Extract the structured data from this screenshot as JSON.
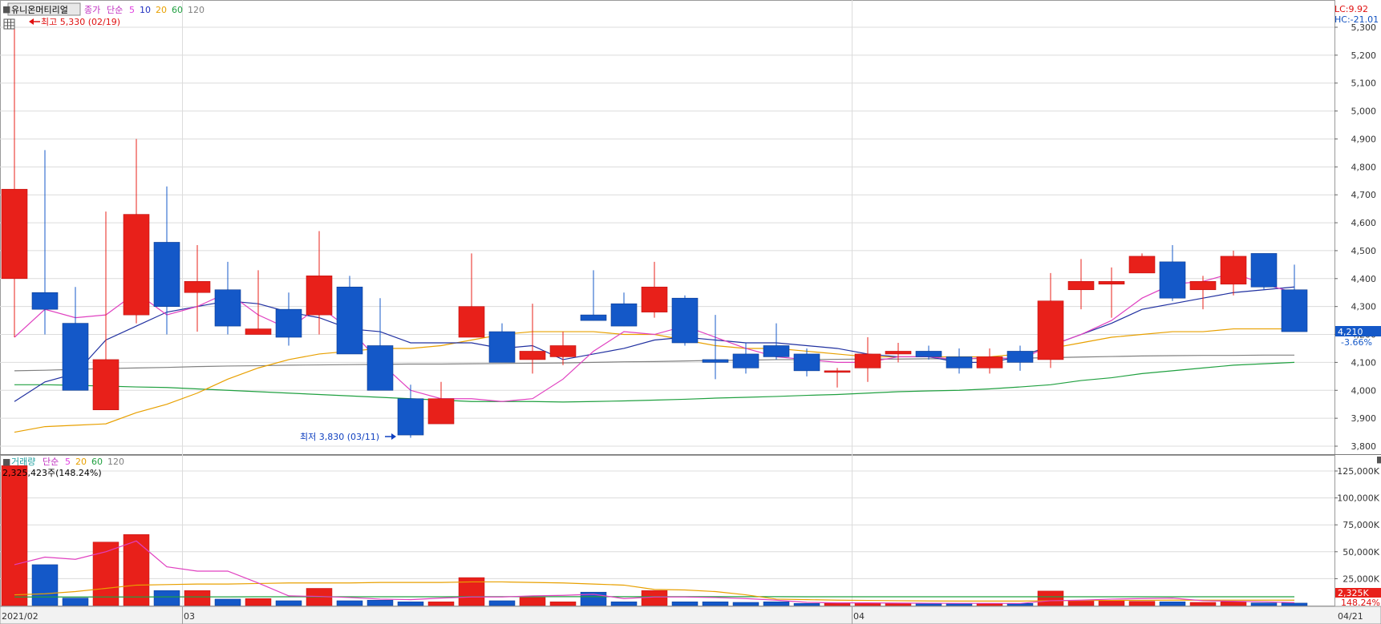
{
  "header": {
    "stock_name": "유니온머티리얼",
    "price_legend": [
      {
        "text": "종가",
        "color": "#c030c0"
      },
      {
        "text": "단순",
        "color": "#c030c0"
      },
      {
        "text": "5",
        "color": "#e040e0"
      },
      {
        "text": "10",
        "color": "#2030c0"
      },
      {
        "text": "20",
        "color": "#e8a000"
      },
      {
        "text": "60",
        "color": "#20a040"
      },
      {
        "text": "120",
        "color": "#808080"
      }
    ],
    "volume_legend": [
      {
        "text": "거래량",
        "color": "#20a0a0"
      },
      {
        "text": "단순",
        "color": "#c030c0"
      },
      {
        "text": "5",
        "color": "#e040e0"
      },
      {
        "text": "20",
        "color": "#e8a000"
      },
      {
        "text": "60",
        "color": "#20a040"
      },
      {
        "text": "120",
        "color": "#808080"
      }
    ],
    "lc": "LC:9.92",
    "hc": "HC:-21.01"
  },
  "annotations": {
    "high": "최고 5,330 (02/19)",
    "low": "최저 3,830 (03/11)",
    "current_price": "4,210",
    "change_pct": "-3.66%",
    "volume_info": "2,325,423주(148.24%)",
    "current_volume": "2,325K",
    "volume_pct": "148.24%"
  },
  "x_labels": [
    "2021/02",
    "03",
    "04",
    "04/21"
  ],
  "colors": {
    "up": "#e8201a",
    "down": "#1458c8",
    "up_edge": "#c01010",
    "down_edge": "#0a3a90"
  },
  "chart_data": {
    "type": "candlestick",
    "price_axis": {
      "min": 3800,
      "max": 5300,
      "step": 100,
      "tick_labels": [
        "3,800",
        "3,900",
        "4,000",
        "4,100",
        "4,200",
        "4,300",
        "4,400",
        "4,500",
        "4,600",
        "4,700",
        "4,800",
        "4,900",
        "5,000",
        "5,100",
        "5,200",
        "5,300"
      ]
    },
    "volume_axis": {
      "min": 0,
      "max": 125000,
      "step": 25000,
      "tick_labels": [
        "25,000K",
        "50,000K",
        "75,000K",
        "100,000K",
        "125,000K"
      ]
    },
    "candles": [
      {
        "o": 4400,
        "h": 5330,
        "l": 4190,
        "c": 4720
      },
      {
        "o": 4350,
        "h": 4860,
        "l": 4200,
        "c": 4290
      },
      {
        "o": 4240,
        "h": 4370,
        "l": 4000,
        "c": 4000
      },
      {
        "o": 3930,
        "h": 4640,
        "l": 3930,
        "c": 4110
      },
      {
        "o": 4270,
        "h": 4900,
        "l": 4240,
        "c": 4630
      },
      {
        "o": 4530,
        "h": 4730,
        "l": 4200,
        "c": 4300
      },
      {
        "o": 4350,
        "h": 4520,
        "l": 4210,
        "c": 4390
      },
      {
        "o": 4360,
        "h": 4460,
        "l": 4200,
        "c": 4230
      },
      {
        "o": 4200,
        "h": 4430,
        "l": 4200,
        "c": 4220
      },
      {
        "o": 4290,
        "h": 4350,
        "l": 4160,
        "c": 4190
      },
      {
        "o": 4270,
        "h": 4570,
        "l": 4200,
        "c": 4410
      },
      {
        "o": 4370,
        "h": 4410,
        "l": 4130,
        "c": 4130
      },
      {
        "o": 4160,
        "h": 4330,
        "l": 4000,
        "c": 4000
      },
      {
        "o": 3970,
        "h": 4020,
        "l": 3830,
        "c": 3840
      },
      {
        "o": 3880,
        "h": 4030,
        "l": 3880,
        "c": 3970
      },
      {
        "o": 4190,
        "h": 4490,
        "l": 4190,
        "c": 4300
      },
      {
        "o": 4210,
        "h": 4240,
        "l": 4100,
        "c": 4100
      },
      {
        "o": 4110,
        "h": 4310,
        "l": 4060,
        "c": 4140
      },
      {
        "o": 4120,
        "h": 4210,
        "l": 4090,
        "c": 4160
      },
      {
        "o": 4270,
        "h": 4430,
        "l": 4250,
        "c": 4250
      },
      {
        "o": 4310,
        "h": 4350,
        "l": 4230,
        "c": 4230
      },
      {
        "o": 4280,
        "h": 4460,
        "l": 4260,
        "c": 4370
      },
      {
        "o": 4330,
        "h": 4340,
        "l": 4160,
        "c": 4170
      },
      {
        "o": 4110,
        "h": 4270,
        "l": 4040,
        "c": 4100
      },
      {
        "o": 4130,
        "h": 4170,
        "l": 4060,
        "c": 4080
      },
      {
        "o": 4160,
        "h": 4240,
        "l": 4110,
        "c": 4120
      },
      {
        "o": 4130,
        "h": 4150,
        "l": 4050,
        "c": 4070
      },
      {
        "o": 4070,
        "h": 4080,
        "l": 4010,
        "c": 4070
      },
      {
        "o": 4080,
        "h": 4190,
        "l": 4030,
        "c": 4130
      },
      {
        "o": 4130,
        "h": 4170,
        "l": 4100,
        "c": 4140
      },
      {
        "o": 4140,
        "h": 4160,
        "l": 4110,
        "c": 4120
      },
      {
        "o": 4120,
        "h": 4150,
        "l": 4060,
        "c": 4080
      },
      {
        "o": 4080,
        "h": 4150,
        "l": 4060,
        "c": 4120
      },
      {
        "o": 4140,
        "h": 4160,
        "l": 4070,
        "c": 4100
      },
      {
        "o": 4110,
        "h": 4420,
        "l": 4080,
        "c": 4320
      },
      {
        "o": 4360,
        "h": 4470,
        "l": 4290,
        "c": 4390
      },
      {
        "o": 4380,
        "h": 4440,
        "l": 4260,
        "c": 4390
      },
      {
        "o": 4420,
        "h": 4490,
        "l": 4420,
        "c": 4480
      },
      {
        "o": 4460,
        "h": 4520,
        "l": 4320,
        "c": 4330
      },
      {
        "o": 4360,
        "h": 4410,
        "l": 4290,
        "c": 4390
      },
      {
        "o": 4380,
        "h": 4500,
        "l": 4340,
        "c": 4480
      },
      {
        "o": 4490,
        "h": 4490,
        "l": 4360,
        "c": 4370
      },
      {
        "o": 4360,
        "h": 4450,
        "l": 4210,
        "c": 4210
      }
    ],
    "ma5": [
      4190,
      4290,
      4260,
      4270,
      4350,
      4270,
      4300,
      4350,
      4270,
      4220,
      4300,
      4220,
      4100,
      4000,
      3970,
      3970,
      3960,
      3970,
      4040,
      4140,
      4210,
      4200,
      4230,
      4190,
      4150,
      4120,
      4110,
      4100,
      4100,
      4120,
      4120,
      4110,
      4120,
      4110,
      4160,
      4200,
      4250,
      4330,
      4380,
      4390,
      4420,
      4380,
      4350
    ],
    "ma10": [
      3960,
      4030,
      4060,
      4180,
      4230,
      4280,
      4300,
      4320,
      4310,
      4280,
      4260,
      4220,
      4210,
      4170,
      4170,
      4170,
      4150,
      4160,
      4110,
      4130,
      4150,
      4180,
      4190,
      4180,
      4170,
      4170,
      4160,
      4150,
      4130,
      4120,
      4120,
      4100,
      4100,
      4120,
      4160,
      4200,
      4240,
      4290,
      4310,
      4330,
      4350,
      4360,
      4370
    ],
    "ma20": [
      3850,
      3870,
      3875,
      3880,
      3920,
      3950,
      3990,
      4040,
      4080,
      4110,
      4130,
      4140,
      4150,
      4150,
      4160,
      4180,
      4200,
      4210,
      4210,
      4210,
      4200,
      4200,
      4180,
      4160,
      4150,
      4150,
      4140,
      4130,
      4120,
      4120,
      4120,
      4120,
      4120,
      4130,
      4150,
      4170,
      4190,
      4200,
      4210,
      4210,
      4220,
      4220,
      4220
    ],
    "ma60": [
      4020,
      4020,
      4018,
      4015,
      4012,
      4010,
      4005,
      4000,
      3995,
      3990,
      3985,
      3980,
      3975,
      3970,
      3965,
      3960,
      3960,
      3960,
      3958,
      3960,
      3962,
      3965,
      3968,
      3972,
      3975,
      3978,
      3982,
      3985,
      3990,
      3995,
      3998,
      4000,
      4005,
      4012,
      4020,
      4035,
      4045,
      4060,
      4070,
      4080,
      4090,
      4095,
      4100
    ],
    "ma120": [
      4070,
      4072,
      4075,
      4078,
      4080,
      4082,
      4085,
      4087,
      4088,
      4090,
      4091,
      4092,
      4093,
      4094,
      4094,
      4095,
      4096,
      4097,
      4098,
      4100,
      4102,
      4103,
      4105,
      4107,
      4108,
      4110,
      4110,
      4111,
      4112,
      4112,
      4113,
      4113,
      4114,
      4115,
      4117,
      4119,
      4121,
      4123,
      4124,
      4125,
      4125,
      4126,
      4126
    ],
    "volume": [
      130000,
      38000,
      7000,
      59000,
      66000,
      14000,
      14000,
      6000,
      6500,
      4500,
      16000,
      4500,
      5000,
      3500,
      3500,
      26000,
      4500,
      7500,
      3500,
      12500,
      3500,
      14000,
      3500,
      3500,
      3000,
      3500,
      2000,
      2000,
      2500,
      2000,
      2000,
      2000,
      2000,
      2000,
      13500,
      5000,
      5000,
      4000,
      3500,
      3000,
      3500,
      2500,
      2325
    ],
    "vol_ma5": [
      38000,
      45000,
      43000,
      50000,
      60000,
      36000,
      32000,
      32000,
      21000,
      9000,
      8500,
      7500,
      6000,
      5500,
      7000,
      8000,
      8000,
      9000,
      9500,
      10500,
      6500,
      8000,
      8000,
      7500,
      6500,
      5000,
      3000,
      2500,
      2500,
      2300,
      2200,
      2100,
      2100,
      2000,
      4500,
      5000,
      6000,
      6500,
      7000,
      4500,
      4000,
      3500,
      2800
    ],
    "vol_ma20": [
      10000,
      11000,
      13000,
      16000,
      19000,
      19500,
      20000,
      20000,
      20500,
      21000,
      21000,
      21000,
      21500,
      21500,
      21500,
      22000,
      22000,
      21500,
      21000,
      20000,
      19000,
      15000,
      14500,
      13000,
      10000,
      6000,
      5500,
      5000,
      4800,
      4500,
      4300,
      4200,
      4200,
      4200,
      4500,
      4700,
      4800,
      4900,
      5000,
      5000,
      5000,
      5000,
      5000
    ],
    "vol_ma60": [
      8000,
      8000,
      8000,
      8000,
      8000,
      8100,
      8100,
      8100,
      8200,
      8200,
      8200,
      8200,
      8200,
      8200,
      8200,
      8300,
      8300,
      8300,
      8300,
      8300,
      8300,
      8300,
      8300,
      8300,
      8300,
      8300,
      8200,
      8200,
      8200,
      8200,
      8200,
      8200,
      8200,
      8200,
      8200,
      8200,
      8200,
      8200,
      8200,
      8200,
      8200,
      8200,
      8200
    ]
  }
}
